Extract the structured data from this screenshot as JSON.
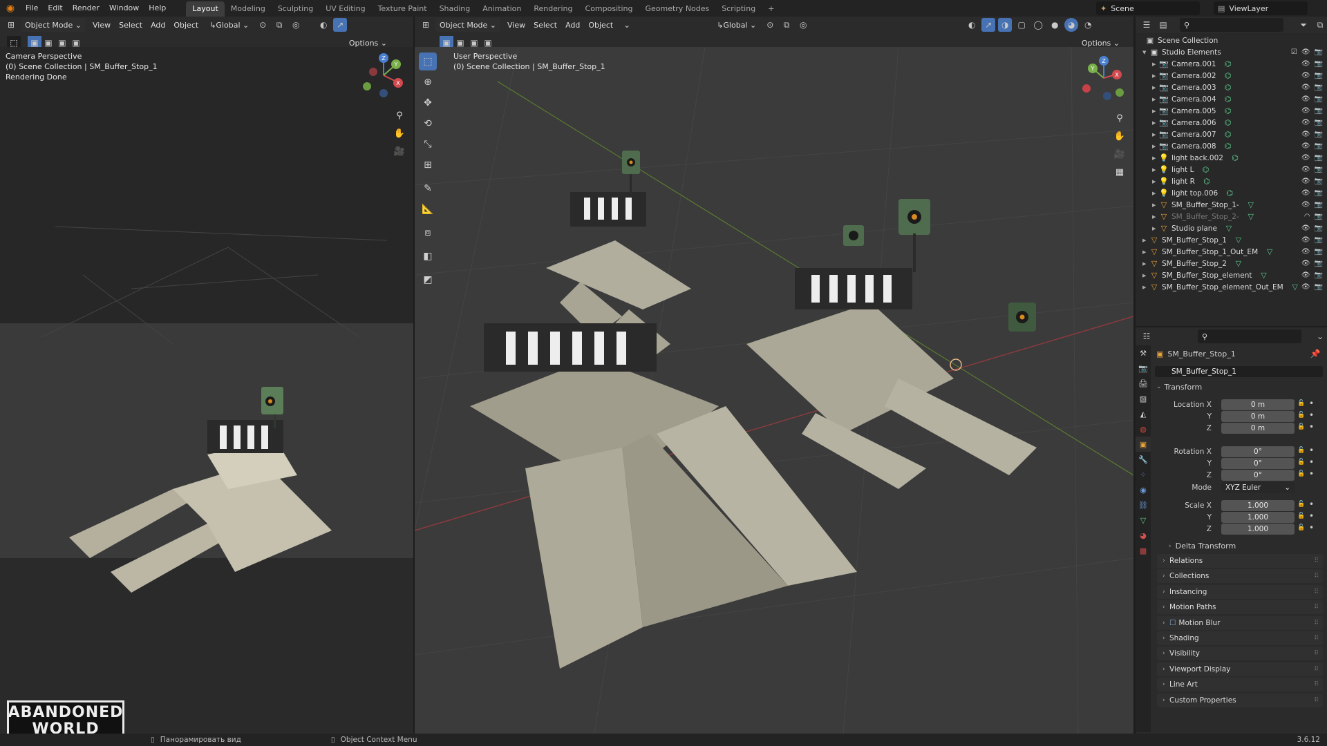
{
  "app": {
    "menus": [
      "File",
      "Edit",
      "Render",
      "Window",
      "Help"
    ],
    "workspaces": [
      "Layout",
      "Modeling",
      "Sculpting",
      "UV Editing",
      "Texture Paint",
      "Shading",
      "Animation",
      "Rendering",
      "Compositing",
      "Geometry Nodes",
      "Scripting",
      "+"
    ],
    "active_workspace": "Layout",
    "scene": "Scene",
    "view_layer": "ViewLayer"
  },
  "left_viewport": {
    "mode": "Object Mode",
    "menus": [
      "View",
      "Select",
      "Add",
      "Object"
    ],
    "orientation": "Global",
    "options": "Options",
    "overlay": [
      "Camera Perspective",
      "(0) Scene Collection | SM_Buffer_Stop_1",
      "Rendering Done"
    ]
  },
  "main_viewport": {
    "mode": "Object Mode",
    "menus": [
      "View",
      "Select",
      "Add",
      "Object"
    ],
    "orientation": "Global",
    "options": "Options",
    "overlay": [
      "User Perspective",
      "(0) Scene Collection | SM_Buffer_Stop_1"
    ]
  },
  "gizmo": {
    "x": "X",
    "y": "Y",
    "z": "Z"
  },
  "outliner": {
    "root": "Scene Collection",
    "rows": [
      {
        "label": "Studio Elements",
        "kind": "collection",
        "level": 1
      },
      {
        "label": "Camera.001",
        "kind": "camera",
        "level": 2
      },
      {
        "label": "Camera.002",
        "kind": "camera",
        "level": 2
      },
      {
        "label": "Camera.003",
        "kind": "camera",
        "level": 2
      },
      {
        "label": "Camera.004",
        "kind": "camera",
        "level": 2
      },
      {
        "label": "Camera.005",
        "kind": "camera",
        "level": 2
      },
      {
        "label": "Camera.006",
        "kind": "camera",
        "level": 2
      },
      {
        "label": "Camera.007",
        "kind": "camera",
        "level": 2
      },
      {
        "label": "Camera.008",
        "kind": "camera",
        "level": 2
      },
      {
        "label": "light back.002",
        "kind": "light",
        "level": 2
      },
      {
        "label": "light L",
        "kind": "light",
        "level": 2
      },
      {
        "label": "light R",
        "kind": "light",
        "level": 2
      },
      {
        "label": "light top.006",
        "kind": "light",
        "level": 2
      },
      {
        "label": "SM_Buffer_Stop_1-",
        "kind": "mesh",
        "level": 2
      },
      {
        "label": "SM_Buffer_Stop_2-",
        "kind": "mesh",
        "level": 2,
        "dim": true
      },
      {
        "label": "Studio plane",
        "kind": "mesh",
        "level": 2
      },
      {
        "label": "SM_Buffer_Stop_1",
        "kind": "mesh",
        "level": 1
      },
      {
        "label": "SM_Buffer_Stop_1_Out_EM",
        "kind": "mesh",
        "level": 1
      },
      {
        "label": "SM_Buffer_Stop_2",
        "kind": "mesh",
        "level": 1
      },
      {
        "label": "SM_Buffer_Stop_element",
        "kind": "mesh",
        "level": 1
      },
      {
        "label": "SM_Buffer_Stop_element_Out_EM",
        "kind": "mesh",
        "level": 1
      }
    ]
  },
  "properties": {
    "object_name": "SM_Buffer_Stop_1",
    "data_name": "SM_Buffer_Stop_1",
    "transform_title": "Transform",
    "location_label": "Location X",
    "rotation_label": "Rotation X",
    "scale_label": "Scale X",
    "y_label": "Y",
    "z_label": "Z",
    "location": [
      "0 m",
      "0 m",
      "0 m"
    ],
    "rotation": [
      "0°",
      "0°",
      "0°"
    ],
    "mode_label": "Mode",
    "mode": "XYZ Euler",
    "scale": [
      "1.000",
      "1.000",
      "1.000"
    ],
    "delta": "Delta Transform",
    "panels": [
      "Relations",
      "Collections",
      "Instancing",
      "Motion Paths",
      "Motion Blur",
      "Shading",
      "Visibility",
      "Viewport Display",
      "Line Art",
      "Custom Properties"
    ]
  },
  "status": {
    "left": "Панорамировать вид",
    "middle": "Object Context Menu",
    "version": "3.6.12"
  },
  "watermark": {
    "line1": "ABANDONED",
    "line2": "WORLD"
  }
}
